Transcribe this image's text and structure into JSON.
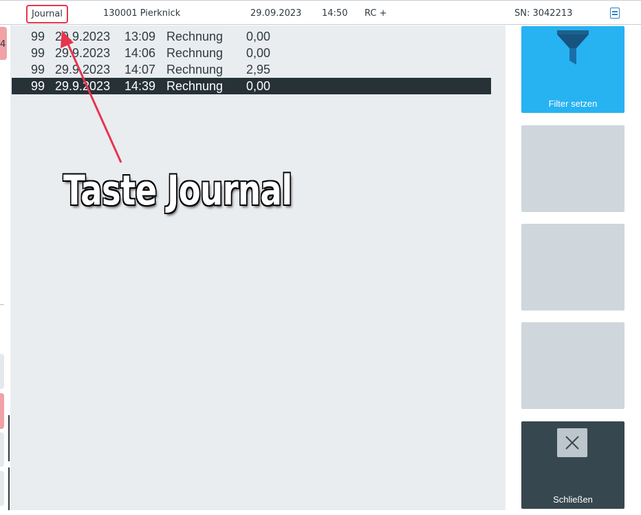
{
  "header": {
    "journal_tab": "Journal",
    "customer": "130001 Pierknick",
    "date": "29.09.2023",
    "time": "14:50",
    "mode": "RC +",
    "serial": "SN: 3042213",
    "doc_icon": "document-icon"
  },
  "left_panel": {
    "partial_digit": "4"
  },
  "journal": {
    "rows": [
      {
        "nr": "99",
        "date": "29.9.2023",
        "time": "13:09",
        "type": "Rechnung",
        "amount": "0,00"
      },
      {
        "nr": "99",
        "date": "29.9.2023",
        "time": "14:06",
        "type": "Rechnung",
        "amount": "0,00"
      },
      {
        "nr": "99",
        "date": "29.9.2023",
        "time": "14:07",
        "type": "Rechnung",
        "amount": "2,95"
      },
      {
        "nr": "99",
        "date": "29.9.2023",
        "time": "14:39",
        "type": "Rechnung",
        "amount": "0,00"
      }
    ],
    "selected_index": 3
  },
  "sidebar": {
    "filter_label": "Filter setzen",
    "filter_icon": "funnel-icon",
    "close_label": "Schließen",
    "close_icon": "close-icon"
  },
  "annotation": {
    "text": "Taste Journal",
    "color": "#e8344e"
  },
  "colors": {
    "accent_blue": "#27b2f2",
    "dark": "#37474f",
    "selection": "#263238"
  }
}
